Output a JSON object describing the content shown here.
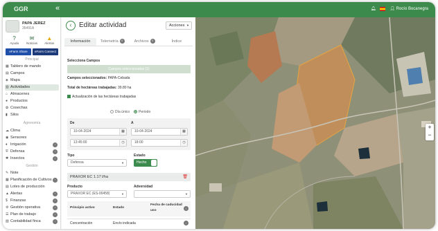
{
  "topbar": {
    "brand": "GGR",
    "user": "Rocío Bocanegra"
  },
  "sidebar": {
    "farm_name": "PAPA JEREZ",
    "farm_id": "35491A",
    "quick": [
      {
        "label": "Ayuda",
        "icon": "help-icon"
      },
      {
        "label": "Noticias",
        "icon": "megaphone-icon"
      },
      {
        "label": "Alertas",
        "icon": "warning-icon"
      }
    ],
    "badges": [
      "eFarm Share",
      "eFarm Connect"
    ],
    "sections": {
      "principal": "Principal",
      "agronomia": "Agronomía",
      "gestion": "Gestión"
    },
    "principal_items": [
      {
        "label": "Tablero de mando",
        "icon": "dashboard-icon"
      },
      {
        "label": "Campos",
        "icon": "fields-icon"
      },
      {
        "label": "Mapa",
        "icon": "map-icon"
      },
      {
        "label": "Actividades",
        "icon": "activities-icon",
        "active": true
      },
      {
        "label": "Almacenes",
        "icon": "warehouse-icon"
      },
      {
        "label": "Productos",
        "icon": "products-icon"
      },
      {
        "label": "Cosechas",
        "icon": "harvest-icon"
      },
      {
        "label": "Silos",
        "icon": "silo-icon"
      }
    ],
    "agronomia_items": [
      {
        "label": "Clima",
        "icon": "weather-icon"
      },
      {
        "label": "Sensores",
        "icon": "sensor-icon"
      },
      {
        "label": "Irrigación",
        "icon": "irrigation-icon"
      },
      {
        "label": "Defensa",
        "icon": "defense-icon"
      },
      {
        "label": "Insectos",
        "icon": "insect-icon"
      }
    ],
    "gestion_items": [
      {
        "label": "Note",
        "icon": "note-icon"
      },
      {
        "label": "Planificación de Cultivos",
        "icon": "planning-icon"
      },
      {
        "label": "Lotes de producción",
        "icon": "lots-icon"
      },
      {
        "label": "Alertas",
        "icon": "alert-icon"
      },
      {
        "label": "Finanzas",
        "icon": "finance-icon"
      },
      {
        "label": "Gestión operativa",
        "icon": "operations-icon"
      },
      {
        "label": "Plan de trabajo",
        "icon": "workplan-icon"
      },
      {
        "label": "Contabilidad finca",
        "icon": "accounting-icon"
      }
    ]
  },
  "panel": {
    "title": "Editar actividad",
    "actions_label": "Acciones",
    "tabs": [
      {
        "label": "Información",
        "active": true
      },
      {
        "label": "Telemetría",
        "count": "0"
      },
      {
        "label": "Archivos",
        "count": "0"
      },
      {
        "label": "Índice"
      }
    ],
    "select_fields_label": "Selecciona Campos",
    "selected_fields_bar": "Campos seleccionados (1)",
    "selected_fields_prefix": "Campos seleccionados:",
    "selected_fields_value": "PAPA-Cebada",
    "worked_total_prefix": "Total de hectáreas trabajadas:",
    "worked_total_value": "39.80 ha",
    "update_checkbox": "Actualización de las hectáreas trabajadas",
    "radio_single": "Día único",
    "radio_period": "Periodo",
    "from_label": "De",
    "to_label": "A",
    "from_date": "10-04-2024",
    "from_time": "13:45:00",
    "to_date": "10-04-2024",
    "to_time": "18:00",
    "type_label": "Tipo",
    "type_value": "Defensa",
    "status_label": "Estado",
    "status_value": "Hecho",
    "product_title": "PRAXOR EC 1.17 l/ha",
    "product_label": "Producto",
    "product_value": "PRAXOR EC (ES-00458)",
    "adversity_label": "Adversidad",
    "table_headers": {
      "principle": "Principio activo",
      "state": "Estado",
      "expiry": "Fecha de caducidad"
    },
    "table_headers_sub": {
      "expiry": "uso"
    },
    "row": {
      "principle": "Concentración",
      "state": "Envío indicada"
    }
  }
}
